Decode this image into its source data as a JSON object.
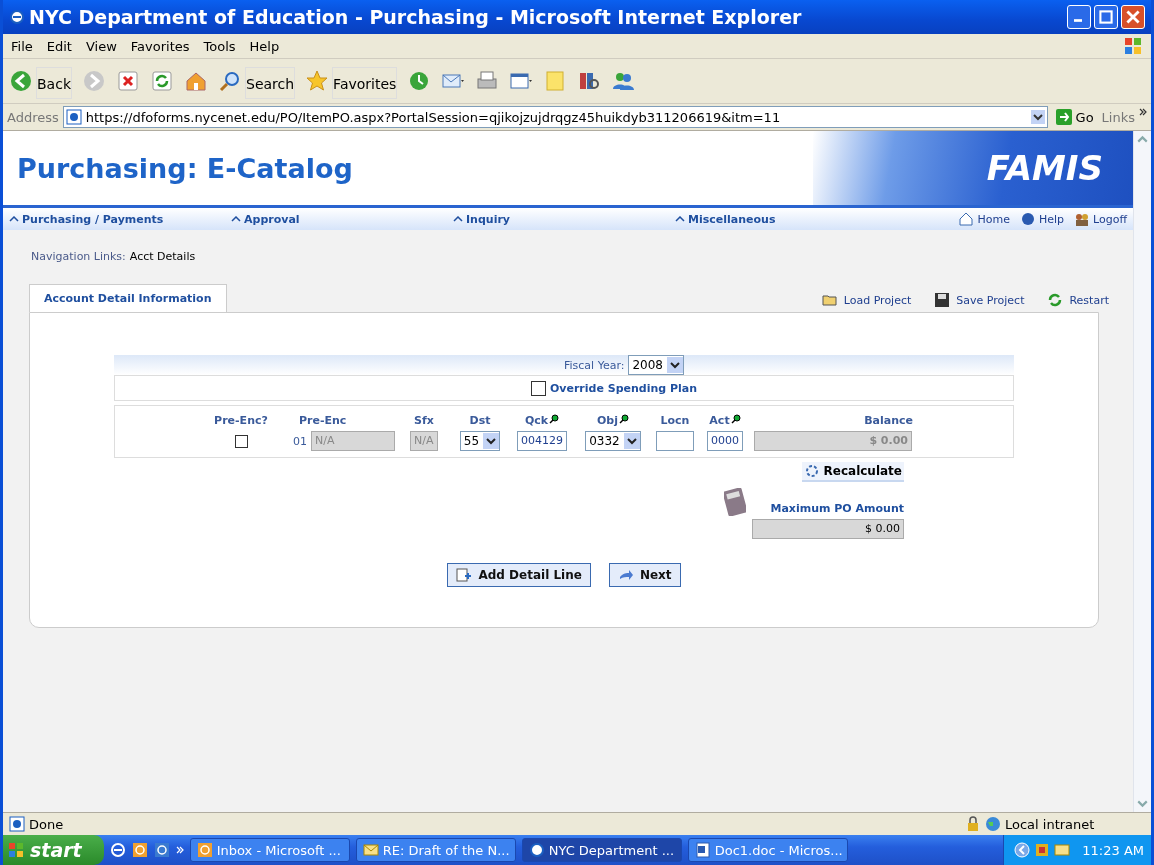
{
  "window": {
    "title": "NYC Department of Education - Purchasing - Microsoft Internet Explorer"
  },
  "menu": [
    "File",
    "Edit",
    "View",
    "Favorites",
    "Tools",
    "Help"
  ],
  "toolbar": [
    {
      "kind": "back",
      "label": "Back"
    },
    {
      "kind": "forward"
    },
    {
      "kind": "stop"
    },
    {
      "kind": "refresh"
    },
    {
      "kind": "home"
    },
    {
      "kind": "search",
      "label": "Search"
    },
    {
      "kind": "favorites",
      "label": "Favorites"
    },
    {
      "kind": "history"
    },
    {
      "kind": "mail"
    },
    {
      "kind": "print"
    },
    {
      "kind": "edit"
    },
    {
      "kind": "note"
    },
    {
      "kind": "research"
    },
    {
      "kind": "messenger"
    }
  ],
  "address": {
    "label": "Address",
    "url": "https://dfoforms.nycenet.edu/PO/ItemPO.aspx?PortalSession=qjikojzujdrqgz45huikdyb311206619&itm=11",
    "go": "Go",
    "links": "Links"
  },
  "page": {
    "title": "Purchasing: E-Catalog",
    "logo": "FAMIS",
    "nav": [
      "Purchasing / Payments",
      "Approval",
      "Inquiry",
      "Miscellaneous"
    ],
    "utility": [
      {
        "kind": "home",
        "label": "Home"
      },
      {
        "kind": "help",
        "label": "Help"
      },
      {
        "kind": "logoff",
        "label": "Logoff"
      }
    ],
    "breadcrumb": {
      "label": "Navigation Links:",
      "value": "Acct Details"
    },
    "tabs": [
      {
        "label": "Account Detail Information",
        "selected": true
      }
    ],
    "actions": [
      {
        "kind": "load",
        "label": "Load Project"
      },
      {
        "kind": "save",
        "label": "Save Project"
      },
      {
        "kind": "restart",
        "label": "Restart"
      }
    ],
    "fiscal_year": {
      "label": "Fiscal Year:",
      "value": "2008"
    },
    "override": {
      "label": "Override Spending Plan",
      "checked": false
    },
    "columns": [
      {
        "label": "Pre-Enc?",
        "lookup": false
      },
      {
        "label": "Pre-Enc",
        "lookup": false
      },
      {
        "label": "Sfx",
        "lookup": false
      },
      {
        "label": "Dst",
        "lookup": false
      },
      {
        "label": "Qck",
        "lookup": true
      },
      {
        "label": "Obj",
        "lookup": true
      },
      {
        "label": "Locn",
        "lookup": false
      },
      {
        "label": "Act",
        "lookup": true
      },
      {
        "label": "Balance",
        "lookup": false
      }
    ],
    "row": {
      "pre_enc_checked": false,
      "line": "01",
      "pre_enc": "N/A",
      "sfx": "N/A",
      "dst": "55",
      "qck": "004129",
      "obj": "0332",
      "act": "0000",
      "balance": "$ 0.00"
    },
    "recalculate": "Recalculate",
    "max_po": {
      "label": "Maximum PO Amount",
      "value": "$ 0.00"
    },
    "buttons": [
      {
        "kind": "add",
        "label": "Add Detail Line"
      },
      {
        "kind": "next",
        "label": "Next"
      }
    ]
  },
  "status_bar": {
    "text": "Done",
    "zone": "Local intranet"
  },
  "taskbar": {
    "start": "start",
    "tasks": [
      {
        "kind": "outlook",
        "label": "Inbox - Microsoft ...",
        "selected": false
      },
      {
        "kind": "mail",
        "label": "RE: Draft of the N...",
        "selected": false
      },
      {
        "kind": "ie",
        "label": "NYC Department ...",
        "selected": true
      },
      {
        "kind": "word",
        "label": "Doc1.doc - Micros...",
        "selected": false
      }
    ],
    "clock": "11:23 AM"
  }
}
